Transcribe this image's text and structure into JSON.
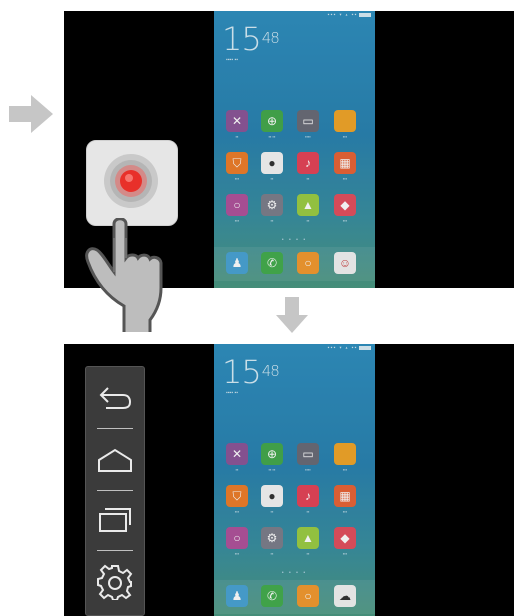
{
  "phone": {
    "time_hours": "15",
    "time_minutes": "48",
    "apps_row1": [
      {
        "name": "close-app",
        "color": "#9a5aa0",
        "glyph": "✕"
      },
      {
        "name": "plus-app",
        "color": "#3faa4a",
        "glyph": "+"
      },
      {
        "name": "window-app",
        "color": "#6c6c7a",
        "glyph": "▭"
      },
      {
        "name": "folder-app",
        "color": "#f2a227",
        "glyph": ""
      }
    ],
    "apps_row2": [
      {
        "name": "bag-app",
        "color": "#ef7d2a",
        "glyph": "⌂"
      },
      {
        "name": "camera-app",
        "color": "#ffffff",
        "glyph": "●"
      },
      {
        "name": "music-app",
        "color": "#e9415a",
        "glyph": "♪"
      },
      {
        "name": "grid-app",
        "color": "#e85c3a",
        "glyph": "▦"
      }
    ],
    "apps_row3": [
      {
        "name": "browser-app",
        "color": "#b2549e",
        "glyph": "○"
      },
      {
        "name": "settings-app",
        "color": "#8a8a96",
        "glyph": "⚙"
      },
      {
        "name": "gallery-app",
        "color": "#9ccf3f",
        "glyph": "▲"
      },
      {
        "name": "theme-app",
        "color": "#e44f5c",
        "glyph": "◆"
      }
    ],
    "dock": [
      {
        "name": "contacts-app",
        "color": "#4fa8d8",
        "glyph": "👤"
      },
      {
        "name": "phone-app",
        "color": "#45b04e",
        "glyph": "✆"
      },
      {
        "name": "message-app",
        "color": "#f29b2e",
        "glyph": "○"
      },
      {
        "name": "avatar-app",
        "color": "#f5f5f5",
        "glyph": "☺"
      }
    ]
  },
  "nav_menu": {
    "items": [
      "back-arrow-icon",
      "home-icon",
      "recent-apps-icon",
      "gear-icon"
    ]
  },
  "colors": {
    "float_button_bg": "#e6e6e6",
    "float_button_dot": "#e8302a",
    "nav_panel_bg": "#3b3b3b"
  }
}
